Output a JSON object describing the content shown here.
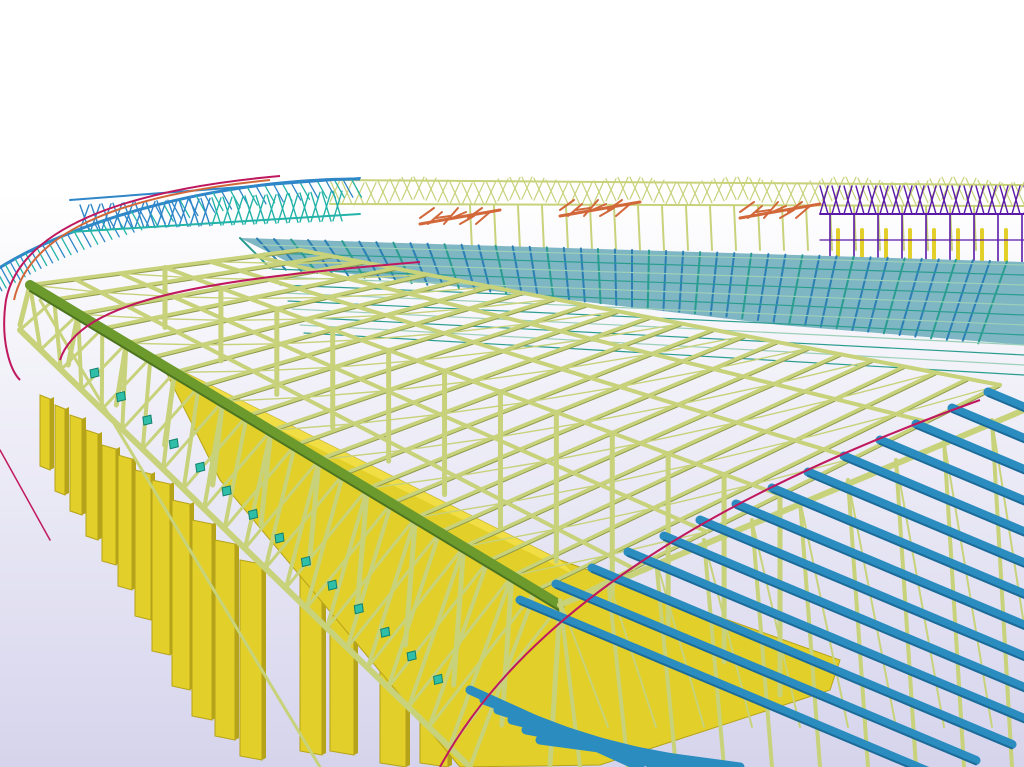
{
  "viewport": {
    "kind": "3d-model-view",
    "background_top": "#ffffff",
    "background_bottom": "#d6d4ec"
  },
  "colors": {
    "truss_main": "#c8d27a",
    "truss_edge": "#8e9a4c",
    "column_yellow": "#e2cf2a",
    "column_shadow": "#b5a31a",
    "purlin_blue": "#2b8cc0",
    "purlin_blue_dark": "#1b6a98",
    "chord_green": "#6c9a2c",
    "roof_teal": "#2a9d8f",
    "roof_blue": "#2b7fb4",
    "arc_magenta": "#c0185e",
    "far_blue": "#2f86c8",
    "far_cyan": "#23b3a8",
    "far_orange": "#d2683a",
    "far_purple": "#5a1aa8",
    "connector_cyan": "#2fbfa8"
  },
  "elements": {
    "near_truss": "near-roof-truss",
    "columns": "support-columns",
    "purlins": "blue-purlins",
    "far_roof": "far-roof-structure"
  }
}
